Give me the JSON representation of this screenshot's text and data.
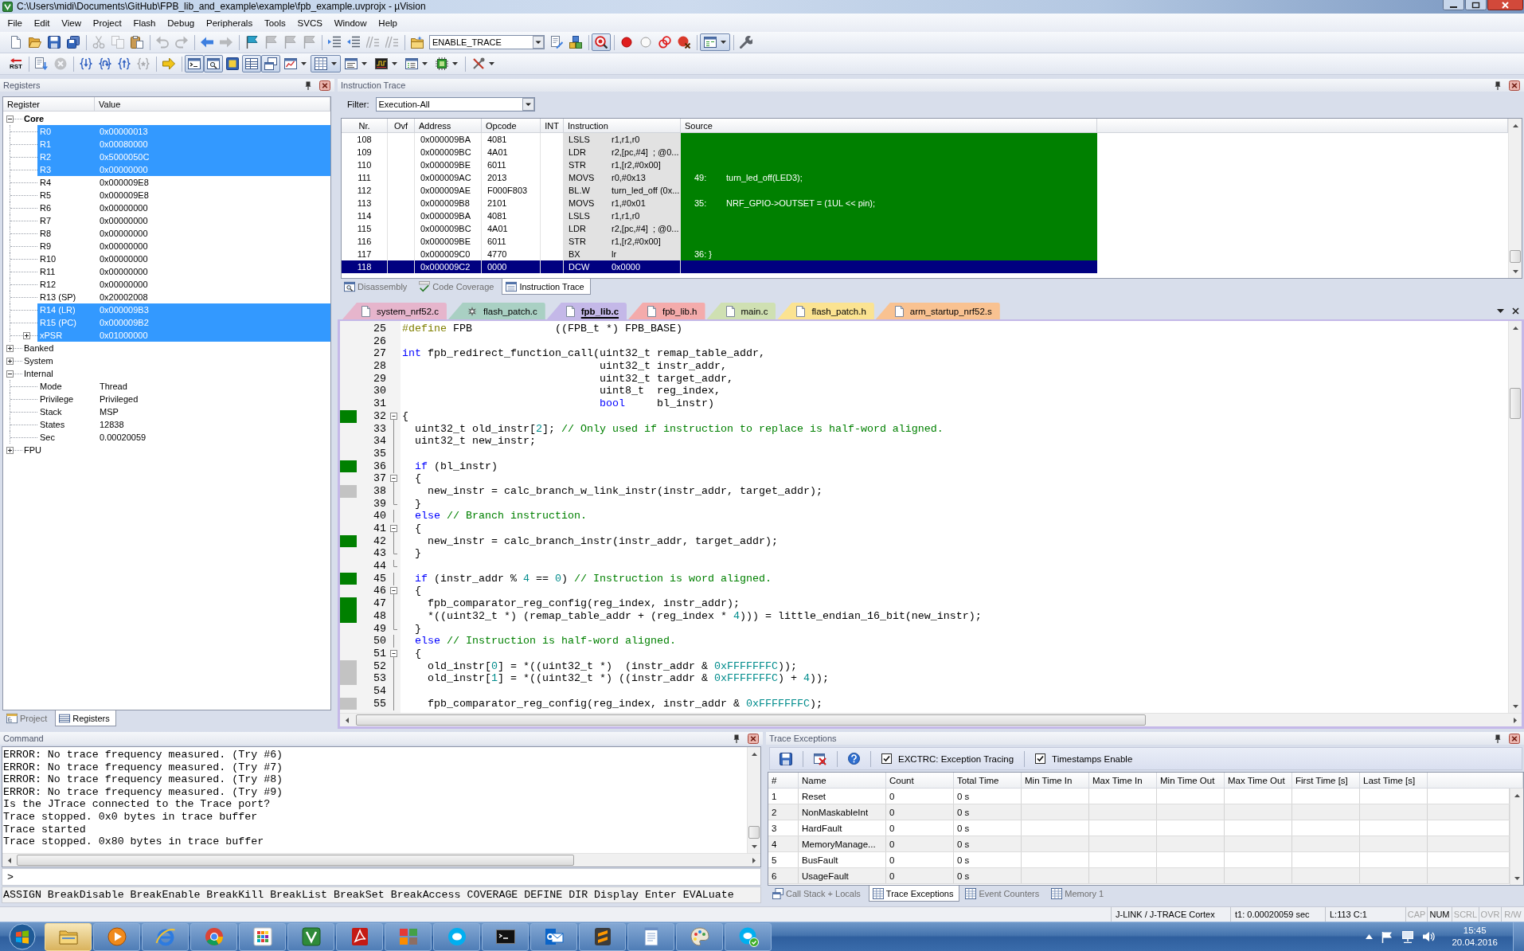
{
  "window": {
    "title": "C:\\Users\\midi\\Documents\\GitHub\\FPB_lib_and_example\\example\\fpb_example.uvprojx - µVision"
  },
  "menu": [
    "File",
    "Edit",
    "View",
    "Project",
    "Flash",
    "Debug",
    "Peripherals",
    "Tools",
    "SVCS",
    "Window",
    "Help"
  ],
  "toolbar": [
    {
      "kind": "new",
      "disabled": false,
      "pressed": false
    },
    {
      "kind": "open",
      "disabled": false,
      "pressed": false
    },
    {
      "kind": "save",
      "disabled": false,
      "pressed": false
    },
    {
      "kind": "saveall",
      "disabled": false,
      "pressed": false
    },
    {
      "kind": "separator"
    },
    {
      "kind": "cut",
      "disabled": true,
      "pressed": false
    },
    {
      "kind": "copy",
      "disabled": true,
      "pressed": false
    },
    {
      "kind": "paste",
      "disabled": false,
      "pressed": false
    },
    {
      "kind": "separator"
    },
    {
      "kind": "undo",
      "disabled": true,
      "pressed": false
    },
    {
      "kind": "redo",
      "disabled": true,
      "pressed": false
    },
    {
      "kind": "separator"
    },
    {
      "kind": "back",
      "disabled": false,
      "pressed": false
    },
    {
      "kind": "forward",
      "disabled": true,
      "pressed": false
    },
    {
      "kind": "separator"
    },
    {
      "kind": "bookmark",
      "disabled": false,
      "pressed": false
    },
    {
      "kind": "bookmarkprev",
      "disabled": true,
      "pressed": false
    },
    {
      "kind": "bookmarknext",
      "disabled": true,
      "pressed": false
    },
    {
      "kind": "bookmarkclear",
      "disabled": true,
      "pressed": false
    },
    {
      "kind": "separator"
    },
    {
      "kind": "indent",
      "disabled": false,
      "pressed": false
    },
    {
      "kind": "outdent",
      "disabled": false,
      "pressed": false
    },
    {
      "kind": "comment",
      "disabled": true,
      "pressed": false
    },
    {
      "kind": "uncomment",
      "disabled": true,
      "pressed": false
    },
    {
      "kind": "separator"
    },
    {
      "kind": "project",
      "disabled": false,
      "pressed": false
    },
    {
      "kind": "select",
      "value": "ENABLE_TRACE"
    },
    {
      "kind": "options",
      "disabled": false,
      "pressed": false
    },
    {
      "kind": "manage",
      "disabled": false,
      "pressed": false
    },
    {
      "kind": "separator"
    },
    {
      "kind": "debug",
      "disabled": false,
      "pressed": true
    },
    {
      "kind": "separator"
    },
    {
      "kind": "breakpoint",
      "disabled": false,
      "pressed": false
    },
    {
      "kind": "enablebreakpoint",
      "disabled": false,
      "pressed": false
    },
    {
      "kind": "disablebreakpoints",
      "disabled": false,
      "pressed": false
    },
    {
      "kind": "killbreakpoints",
      "disabled": false,
      "pressed": false
    },
    {
      "kind": "separator"
    },
    {
      "kind": "windows",
      "disabled": false,
      "pressed": true
    },
    {
      "kind": "separator"
    },
    {
      "kind": "configure",
      "disabled": false,
      "pressed": false
    }
  ],
  "debug_toolbar": [
    {
      "kind": "reset",
      "label": "RST",
      "disabled": false,
      "pressed": false
    },
    {
      "kind": "separator"
    },
    {
      "kind": "run",
      "disabled": false,
      "pressed": false
    },
    {
      "kind": "stop",
      "disabled": true,
      "pressed": false
    },
    {
      "kind": "separator"
    },
    {
      "kind": "stepinto",
      "disabled": false,
      "pressed": false
    },
    {
      "kind": "stepover",
      "disabled": false,
      "pressed": false
    },
    {
      "kind": "stepout",
      "disabled": false,
      "pressed": false
    },
    {
      "kind": "runtocursor",
      "disabled": true,
      "pressed": false
    },
    {
      "kind": "separator"
    },
    {
      "kind": "showpc",
      "disabled": false,
      "pressed": false
    },
    {
      "kind": "separator"
    },
    {
      "kind": "commandwindow",
      "disabled": false,
      "pressed": true
    },
    {
      "kind": "disassemblywindow",
      "disabled": false,
      "pressed": true
    },
    {
      "kind": "symbolswindow",
      "disabled": false,
      "pressed": false
    },
    {
      "kind": "registerswindow",
      "disabled": false,
      "pressed": true
    },
    {
      "kind": "callstackwindow",
      "disabled": false,
      "pressed": true
    },
    {
      "kind": "watchwindow",
      "disabled": false,
      "pressed": false
    },
    {
      "kind": "memorywindow",
      "disabled": false,
      "pressed": true
    },
    {
      "kind": "serialwindow",
      "disabled": false,
      "pressed": false
    },
    {
      "kind": "analysiswindow",
      "disabled": false,
      "pressed": false
    },
    {
      "kind": "systemviewer",
      "disabled": false,
      "pressed": false
    },
    {
      "kind": "tracewindow",
      "disabled": false,
      "pressed": false
    },
    {
      "kind": "separator"
    },
    {
      "kind": "toolbox",
      "disabled": false,
      "pressed": false
    }
  ],
  "registers": {
    "title": "Registers",
    "columns": [
      "Register",
      "Value"
    ],
    "tree": [
      {
        "name": "Core",
        "expanded": true,
        "selected": false,
        "emphasized": true,
        "children": [
          {
            "name": "R0",
            "value": "0x00000013",
            "selected": true
          },
          {
            "name": "R1",
            "value": "0x00080000",
            "selected": true
          },
          {
            "name": "R2",
            "value": "0x5000050C",
            "selected": true
          },
          {
            "name": "R3",
            "value": "0x00000000",
            "selected": true
          },
          {
            "name": "R4",
            "value": "0x000009E8",
            "selected": false
          },
          {
            "name": "R5",
            "value": "0x000009E8",
            "selected": false
          },
          {
            "name": "R6",
            "value": "0x00000000",
            "selected": false
          },
          {
            "name": "R7",
            "value": "0x00000000",
            "selected": false
          },
          {
            "name": "R8",
            "value": "0x00000000",
            "selected": false
          },
          {
            "name": "R9",
            "value": "0x00000000",
            "selected": false
          },
          {
            "name": "R10",
            "value": "0x00000000",
            "selected": false
          },
          {
            "name": "R11",
            "value": "0x00000000",
            "selected": false
          },
          {
            "name": "R12",
            "value": "0x00000000",
            "selected": false
          },
          {
            "name": "R13 (SP)",
            "value": "0x20002008",
            "selected": false
          },
          {
            "name": "R14 (LR)",
            "value": "0x000009B3",
            "selected": true
          },
          {
            "name": "R15 (PC)",
            "value": "0x000009B2",
            "selected": true
          },
          {
            "name": "xPSR",
            "value": "0x01000000",
            "selected": true,
            "expanded": false
          }
        ]
      },
      {
        "name": "Banked",
        "expanded": false,
        "selected": false,
        "emphasized": false
      },
      {
        "name": "System",
        "expanded": false,
        "selected": false,
        "emphasized": false
      },
      {
        "name": "Internal",
        "expanded": true,
        "selected": false,
        "emphasized": false,
        "children": [
          {
            "name": "Mode",
            "value": "Thread",
            "selected": false
          },
          {
            "name": "Privilege",
            "value": "Privileged",
            "selected": false
          },
          {
            "name": "Stack",
            "value": "MSP",
            "selected": false
          },
          {
            "name": "States",
            "value": "12838",
            "selected": false
          },
          {
            "name": "Sec",
            "value": "0.00020059",
            "selected": false
          }
        ]
      },
      {
        "name": "FPU",
        "expanded": false,
        "selected": false,
        "emphasized": false
      }
    ],
    "tabs": [
      {
        "label": "Project",
        "selected": false
      },
      {
        "label": "Registers",
        "selected": true
      }
    ]
  },
  "instruction_trace": {
    "title": "Instruction Trace",
    "filter": {
      "label": "Filter:",
      "value": "Execution-All"
    },
    "columns": [
      "Nr.",
      "Ovf",
      "Address",
      "Opcode",
      "INT",
      "Instruction",
      "Source"
    ],
    "rows": [
      {
        "nr": "108",
        "address": "0x000009BA",
        "opcode": "4081",
        "mnemonic": "LSLS",
        "operands": "r1,r1,r0",
        "selected": false
      },
      {
        "nr": "109",
        "address": "0x000009BC",
        "opcode": "4A01",
        "mnemonic": "LDR",
        "operands": "r2,[pc,#4]  ; @0...",
        "selected": false
      },
      {
        "nr": "110",
        "address": "0x000009BE",
        "opcode": "6011",
        "mnemonic": "STR",
        "operands": "r1,[r2,#0x00]",
        "selected": false
      },
      {
        "nr": "111",
        "address": "0x000009AC",
        "opcode": "2013",
        "mnemonic": "MOVS",
        "operands": "r0,#0x13",
        "source": "49:\tturn_led_off(LED3);",
        "selected": false
      },
      {
        "nr": "112",
        "address": "0x000009AE",
        "opcode": "F000F803",
        "mnemonic": "BL.W",
        "operands": "turn_led_off (0x...",
        "selected": false
      },
      {
        "nr": "113",
        "address": "0x000009B8",
        "opcode": "2101",
        "mnemonic": "MOVS",
        "operands": "r1,#0x01",
        "source": "35:\tNRF_GPIO->OUTSET = (1UL << pin);",
        "selected": false
      },
      {
        "nr": "114",
        "address": "0x000009BA",
        "opcode": "4081",
        "mnemonic": "LSLS",
        "operands": "r1,r1,r0",
        "selected": false
      },
      {
        "nr": "115",
        "address": "0x000009BC",
        "opcode": "4A01",
        "mnemonic": "LDR",
        "operands": "r2,[pc,#4]  ; @0...",
        "selected": false
      },
      {
        "nr": "116",
        "address": "0x000009BE",
        "opcode": "6011",
        "mnemonic": "STR",
        "operands": "r1,[r2,#0x00]",
        "selected": false
      },
      {
        "nr": "117",
        "address": "0x000009C0",
        "opcode": "4770",
        "mnemonic": "BX",
        "operands": "lr",
        "source": "36: }",
        "selected": false
      },
      {
        "nr": "118",
        "address": "0x000009C2",
        "opcode": "0000",
        "mnemonic": "DCW",
        "operands": "0x0000",
        "selected": true
      }
    ],
    "tabs": [
      {
        "label": "Disassembly",
        "selected": false
      },
      {
        "label": "Code Coverage",
        "selected": false
      },
      {
        "label": "Instruction Trace",
        "selected": true
      }
    ]
  },
  "editor": {
    "tabs": [
      {
        "label": "system_nrf52.c",
        "selected": false,
        "modified": false,
        "color": "#e6b5cc"
      },
      {
        "label": "flash_patch.c",
        "selected": false,
        "modified": true,
        "color": "#a9d0c3"
      },
      {
        "label": "fpb_lib.c",
        "selected": true,
        "modified": false,
        "color": "#c4b8e8"
      },
      {
        "label": "fpb_lib.h",
        "selected": false,
        "modified": false,
        "color": "#f4abab"
      },
      {
        "label": "main.c",
        "selected": false,
        "modified": false,
        "color": "#cfe0b2"
      },
      {
        "label": "flash_patch.h",
        "selected": false,
        "modified": false,
        "color": "#fbe391"
      },
      {
        "label": "arm_startup_nrf52.s",
        "selected": false,
        "modified": false,
        "color": "#f9c291"
      }
    ],
    "lines": [
      {
        "number": "25",
        "code": [
          {
            "kind": "preprocessor",
            "text": "#define"
          },
          {
            "kind": "plain",
            "text": " FPB             ((FPB_t *) FPB_BASE)"
          }
        ]
      },
      {
        "number": "26"
      },
      {
        "number": "27",
        "code": [
          {
            "kind": "keyword",
            "text": "int"
          },
          {
            "kind": "plain",
            "text": " fpb_redirect_function_call(uint32_t remap_table_addr,"
          }
        ]
      },
      {
        "number": "28",
        "code": [
          {
            "kind": "plain",
            "text": "                               uint32_t instr_addr,"
          }
        ]
      },
      {
        "number": "29",
        "code": [
          {
            "kind": "plain",
            "text": "                               uint32_t target_addr,"
          }
        ]
      },
      {
        "number": "30",
        "code": [
          {
            "kind": "plain",
            "text": "                               uint8_t  reg_index,"
          }
        ]
      },
      {
        "number": "31",
        "code": [
          {
            "kind": "keyword",
            "text": "                               bool"
          },
          {
            "kind": "plain",
            "text": "     bl_instr)"
          }
        ]
      },
      {
        "number": "32",
        "coverage": {
          "executed": true
        },
        "fold": {
          "start": true,
          "end": false
        },
        "code": [
          {
            "kind": "plain",
            "text": "{"
          }
        ]
      },
      {
        "number": "33",
        "fold": {
          "start": false,
          "end": false
        },
        "code": [
          {
            "kind": "plain",
            "text": "  uint32_t old_instr["
          },
          {
            "kind": "number",
            "text": "2"
          },
          {
            "kind": "plain",
            "text": "]; "
          },
          {
            "kind": "comment",
            "text": "// Only used if instruction to replace is half-word aligned."
          }
        ]
      },
      {
        "number": "34",
        "fold": {
          "start": false,
          "end": false
        },
        "code": [
          {
            "kind": "plain",
            "text": "  uint32_t new_instr;"
          }
        ]
      },
      {
        "number": "35",
        "fold": {
          "start": false,
          "end": false
        }
      },
      {
        "number": "36",
        "coverage": {
          "executed": true
        },
        "fold": {
          "start": false,
          "end": false
        },
        "code": [
          {
            "kind": "keyword",
            "text": "  if"
          },
          {
            "kind": "plain",
            "text": " (bl_instr)"
          }
        ]
      },
      {
        "number": "37",
        "fold": {
          "start": true,
          "end": false
        },
        "code": [
          {
            "kind": "plain",
            "text": "  {"
          }
        ]
      },
      {
        "number": "38",
        "coverage": {
          "executed": false
        },
        "fold": {
          "start": false,
          "end": false
        },
        "code": [
          {
            "kind": "plain",
            "text": "    new_instr = calc_branch_w_link_instr(instr_addr, target_addr);"
          }
        ]
      },
      {
        "number": "39",
        "fold": {
          "start": false,
          "end": true
        },
        "code": [
          {
            "kind": "plain",
            "text": "  }"
          }
        ]
      },
      {
        "number": "40",
        "fold": {
          "start": false,
          "end": false
        },
        "code": [
          {
            "kind": "keyword",
            "text": "  else"
          },
          {
            "kind": "comment",
            "text": " // Branch instruction."
          }
        ]
      },
      {
        "number": "41",
        "fold": {
          "start": true,
          "end": false
        },
        "code": [
          {
            "kind": "plain",
            "text": "  {"
          }
        ]
      },
      {
        "number": "42",
        "coverage": {
          "executed": true
        },
        "fold": {
          "start": false,
          "end": false
        },
        "code": [
          {
            "kind": "plain",
            "text": "    new_instr = calc_branch_instr(instr_addr, target_addr);"
          }
        ]
      },
      {
        "number": "43",
        "fold": {
          "start": false,
          "end": true
        },
        "code": [
          {
            "kind": "plain",
            "text": "  }"
          }
        ]
      },
      {
        "number": "44",
        "fold": {
          "start": false,
          "end": true
        }
      },
      {
        "number": "45",
        "coverage": {
          "executed": true
        },
        "fold": {
          "start": false,
          "end": false
        },
        "code": [
          {
            "kind": "keyword",
            "text": "  if"
          },
          {
            "kind": "plain",
            "text": " (instr_addr % "
          },
          {
            "kind": "number",
            "text": "4"
          },
          {
            "kind": "plain",
            "text": " == "
          },
          {
            "kind": "number",
            "text": "0"
          },
          {
            "kind": "plain",
            "text": ") "
          },
          {
            "kind": "comment",
            "text": "// Instruction is word aligned."
          }
        ]
      },
      {
        "number": "46",
        "fold": {
          "start": true,
          "end": false
        },
        "code": [
          {
            "kind": "plain",
            "text": "  {"
          }
        ]
      },
      {
        "number": "47",
        "coverage": {
          "executed": true
        },
        "fold": {
          "start": false,
          "end": false
        },
        "code": [
          {
            "kind": "plain",
            "text": "    fpb_comparator_reg_config(reg_index, instr_addr);"
          }
        ]
      },
      {
        "number": "48",
        "coverage": {
          "executed": true
        },
        "fold": {
          "start": false,
          "end": false
        },
        "code": [
          {
            "kind": "plain",
            "text": "    *((uint32_t *) (remap_table_addr + (reg_index * "
          },
          {
            "kind": "number",
            "text": "4"
          },
          {
            "kind": "plain",
            "text": "))) = little_endian_16_bit(new_instr);"
          }
        ]
      },
      {
        "number": "49",
        "fold": {
          "start": false,
          "end": true
        },
        "code": [
          {
            "kind": "plain",
            "text": "  }"
          }
        ]
      },
      {
        "number": "50",
        "fold": {
          "start": false,
          "end": false
        },
        "code": [
          {
            "kind": "keyword",
            "text": "  else"
          },
          {
            "kind": "comment",
            "text": " // Instruction is half-word aligned."
          }
        ]
      },
      {
        "number": "51",
        "fold": {
          "start": true,
          "end": false
        },
        "code": [
          {
            "kind": "plain",
            "text": "  {"
          }
        ]
      },
      {
        "number": "52",
        "coverage": {
          "executed": false
        },
        "fold": {
          "start": false,
          "end": false
        },
        "code": [
          {
            "kind": "plain",
            "text": "    old_instr["
          },
          {
            "kind": "number",
            "text": "0"
          },
          {
            "kind": "plain",
            "text": "] = *((uint32_t *)  (instr_addr & "
          },
          {
            "kind": "number",
            "text": "0xFFFFFFFC"
          },
          {
            "kind": "plain",
            "text": "));"
          }
        ]
      },
      {
        "number": "53",
        "coverage": {
          "executed": false
        },
        "fold": {
          "start": false,
          "end": false
        },
        "code": [
          {
            "kind": "plain",
            "text": "    old_instr["
          },
          {
            "kind": "number",
            "text": "1"
          },
          {
            "kind": "plain",
            "text": "] = *((uint32_t *) ((instr_addr & "
          },
          {
            "kind": "number",
            "text": "0xFFFFFFFC"
          },
          {
            "kind": "plain",
            "text": ") + "
          },
          {
            "kind": "number",
            "text": "4"
          },
          {
            "kind": "plain",
            "text": "));"
          }
        ]
      },
      {
        "number": "54",
        "fold": {
          "start": false,
          "end": false
        }
      },
      {
        "number": "55",
        "coverage": {
          "executed": false
        },
        "fold": {
          "start": false,
          "end": false
        },
        "code": [
          {
            "kind": "plain",
            "text": "    fpb_comparator_reg_config(reg_index, instr_addr & "
          },
          {
            "kind": "number",
            "text": "0xFFFFFFFC"
          },
          {
            "kind": "plain",
            "text": ");"
          }
        ]
      }
    ]
  },
  "command": {
    "title": "Command",
    "output": [
      "ERROR: No trace frequency measured. (Try #6)",
      "ERROR: No trace frequency measured. (Try #7)",
      "ERROR: No trace frequency measured. (Try #8)",
      "ERROR: No trace frequency measured. (Try #9)",
      "Is the JTrace connected to the Trace port?",
      "Trace stopped. 0x0 bytes in trace buffer",
      "Trace started",
      "Trace stopped. 0x80 bytes in trace buffer"
    ],
    "prompt": ">",
    "hint": "ASSIGN BreakDisable BreakEnable BreakKill BreakList BreakSet BreakAccess COVERAGE DEFINE DIR Display Enter EVALuate"
  },
  "trace_exceptions": {
    "title": "Trace Exceptions",
    "options": [
      {
        "label": "EXCTRC: Exception Tracing",
        "checked": true
      },
      {
        "label": "Timestamps Enable",
        "checked": true
      }
    ],
    "columns": [
      "#",
      "Name",
      "Count",
      "Total Time",
      "Min Time In",
      "Max Time In",
      "Min Time Out",
      "Max Time Out",
      "First Time [s]",
      "Last Time [s]"
    ],
    "rows": [
      {
        "number": "1",
        "name": "Reset",
        "count": "0",
        "total_time": "0 s"
      },
      {
        "number": "2",
        "name": "NonMaskableInt",
        "count": "0",
        "total_time": "0 s"
      },
      {
        "number": "3",
        "name": "HardFault",
        "count": "0",
        "total_time": "0 s"
      },
      {
        "number": "4",
        "name": "MemoryManage...",
        "count": "0",
        "total_time": "0 s"
      },
      {
        "number": "5",
        "name": "BusFault",
        "count": "0",
        "total_time": "0 s"
      },
      {
        "number": "6",
        "name": "UsageFault",
        "count": "0",
        "total_time": "0 s"
      }
    ],
    "tabs": [
      {
        "label": "Call Stack + Locals",
        "selected": false
      },
      {
        "label": "Trace Exceptions",
        "selected": true
      },
      {
        "label": "Event Counters",
        "selected": false
      },
      {
        "label": "Memory 1",
        "selected": false
      }
    ]
  },
  "status_bar": {
    "debugger": "J-LINK / J-TRACE Cortex",
    "time": "t1: 0.00020059 sec",
    "cursor": "L:113 C:1",
    "indicators": [
      {
        "label": "CAP",
        "on": false
      },
      {
        "label": "NUM",
        "on": true
      },
      {
        "label": "SCRL",
        "on": false
      },
      {
        "label": "OVR",
        "on": false
      },
      {
        "label": "R/W",
        "on": false
      }
    ]
  },
  "taskbar": {
    "apps": [
      {
        "kind": "folder",
        "active": true
      },
      {
        "kind": "player",
        "active": false
      },
      {
        "kind": "browser",
        "active": false
      },
      {
        "kind": "ball",
        "active": false
      },
      {
        "kind": "grid",
        "active": false
      },
      {
        "kind": "logo",
        "active": false
      },
      {
        "kind": "document",
        "active": false
      },
      {
        "kind": "blocks",
        "active": false
      },
      {
        "kind": "chat",
        "active": false
      },
      {
        "kind": "terminal",
        "active": false
      },
      {
        "kind": "mail",
        "active": false
      },
      {
        "kind": "editor",
        "active": false
      },
      {
        "kind": "notepad",
        "active": false
      },
      {
        "kind": "palette",
        "active": false
      },
      {
        "kind": "chatcheck",
        "active": false
      }
    ],
    "time": "15:45",
    "date": "20.04.2016"
  }
}
